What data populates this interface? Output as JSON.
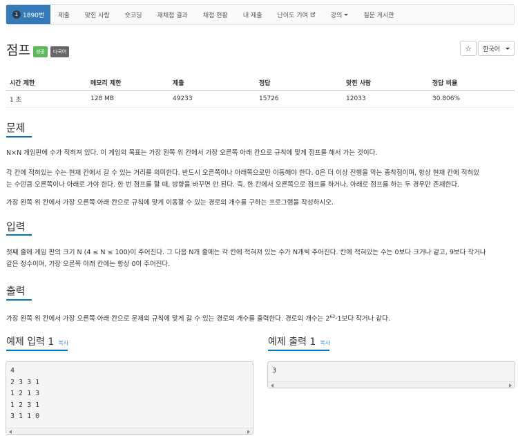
{
  "nav": {
    "problem_number": "1890번",
    "problem_badge": "1",
    "items": [
      "제출",
      "맞힌 사람",
      "숏코딩",
      "재채점 결과",
      "채점 현황",
      "내 제출",
      "난이도 기여",
      "강의",
      "질문 게시판"
    ]
  },
  "title": "점프",
  "labels": {
    "success": "성공",
    "multilang": "다국어"
  },
  "tools": {
    "star_icon": "☆",
    "language": "한국어"
  },
  "info_table": {
    "headers": [
      "시간 제한",
      "메모리 제한",
      "제출",
      "정답",
      "맞힌 사람",
      "정답 비율"
    ],
    "row": [
      "1 초",
      "128 MB",
      "49233",
      "15726",
      "12033",
      "30.806%"
    ]
  },
  "sections": {
    "problem_title": "문제",
    "problem_p1": "N×N 게임판에 수가 적혀져 있다. 이 게임의 목표는 가장 왼쪽 위 칸에서 가장 오른쪽 아래 칸으로 규칙에 맞게 점프를 해서 가는 것이다.",
    "problem_p2_line1": "각 칸에 적혀있는 수는 현재 칸에서 갈 수 있는 거리를 의미한다. 반드시 오른쪽이나 아래쪽으로만 이동해야 한다. 0은 더 이상 진행을 막는 종착점이며, 항상 현재 칸에 적혀있",
    "problem_p2_line2": "는 수만큼 오른쪽이나 아래로 가야 한다. 한 번 점프를 할 때, 방향을 바꾸면 안 된다. 즉, 한 칸에서 오른쪽으로 점프를 하거나, 아래로 점프를 하는 두 경우만 존재한다.",
    "problem_p3": "가장 왼쪽 위 칸에서 가장 오른쪽 아래 칸으로 규칙에 맞게 이동할 수 있는 경로의 개수를 구하는 프로그램을 작성하시오.",
    "input_title": "입력",
    "input_line1": "첫째 줄에 게임 판의 크기 N (4 ≤ N ≤ 100)이 주어진다. 그 다음 N개 줄에는 각 칸에 적혀져 있는 수가 N개씩 주어진다. 칸에 적혀있는 수는 0보다 크거나 같고, 9보다 작거나",
    "input_line2": "같은 정수이며, 가장 오른쪽 아래 칸에는 항상 0이 주어진다.",
    "output_title": "출력",
    "output_pre": "가장 왼쪽 위 칸에서 가장 오른쪽 아래 칸으로 문제의 규칙에 맞게 갈 수 있는 경로의 개수를 출력한다. 경로의 개수는 2",
    "output_sup": "63",
    "output_post": "-1보다 작거나 같다."
  },
  "samples": {
    "input_title": "예제 입력 1",
    "output_title": "예제 출력 1",
    "copy_label": "복사",
    "input_lines": [
      "4",
      "2 3 3 1",
      "1 2 1 3",
      "1 2 3 1",
      "3 1 1 0"
    ],
    "output_lines": [
      "3"
    ]
  },
  "colors": {
    "accent": "#0076c0",
    "nav_active": "#337ab7",
    "success": "#5cb85c"
  }
}
